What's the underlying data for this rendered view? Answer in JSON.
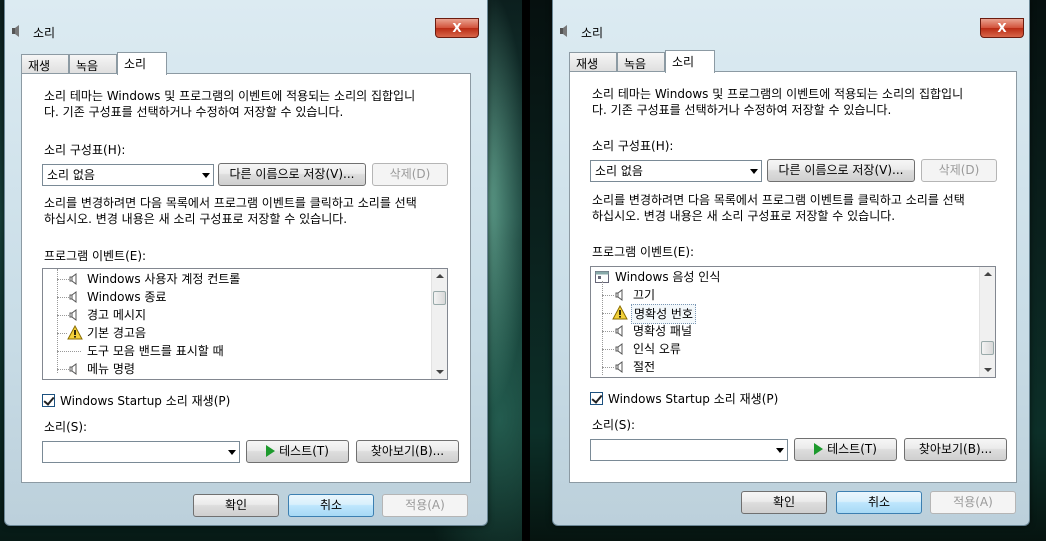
{
  "left": {
    "title": "소리",
    "close_label": "X",
    "tabs": [
      {
        "label": "재생"
      },
      {
        "label": "녹음"
      },
      {
        "label": "소리"
      }
    ],
    "description": "소리 테마는 Windows 및 프로그램의 이벤트에 적용되는 소리의 집합입니\n다. 기존 구성표를 선택하거나 수정하여 저장할 수 있습니다.",
    "scheme_label": "소리 구성표(H):",
    "scheme_value": "소리 없음",
    "save_as_label": "다른 이름으로 저장(V)...",
    "delete_label": "삭제(D)",
    "instruction": "소리를 변경하려면 다음 목록에서 프로그램 이벤트를 클릭하고 소리를 선택\n하십시오. 변경 내용은 새 소리 구성표로 저장할 수 있습니다.",
    "events_label": "프로그램 이벤트(E):",
    "events": [
      {
        "label": "Windows 사용자 계정 컨트롤",
        "icon": "speaker-icon"
      },
      {
        "label": "Windows 종료",
        "icon": "speaker-icon"
      },
      {
        "label": "경고 메시지",
        "icon": "speaker-icon"
      },
      {
        "label": "기본 경고음",
        "icon": "warning-icon"
      },
      {
        "label": "도구 모음 밴드를 표시할 때",
        "icon": ""
      },
      {
        "label": "메뉴 명령",
        "icon": "speaker-icon"
      }
    ],
    "startup_label": "Windows Startup 소리 재생(P)",
    "startup_checked": true,
    "sound_label": "소리(S):",
    "sound_value": "",
    "test_label": "테스트(T)",
    "browse_label": "찾아보기(B)...",
    "ok_label": "확인",
    "cancel_label": "취소",
    "apply_label": "적용(A)"
  },
  "right": {
    "title": "소리",
    "close_label": "X",
    "tabs": [
      {
        "label": "재생"
      },
      {
        "label": "녹음"
      },
      {
        "label": "소리"
      }
    ],
    "description": "소리 테마는 Windows 및 프로그램의 이벤트에 적용되는 소리의 집합입니\n다. 기존 구성표를 선택하거나 수정하여 저장할 수 있습니다.",
    "scheme_label": "소리 구성표(H):",
    "scheme_value": "소리 없음",
    "save_as_label": "다른 이름으로 저장(V)...",
    "delete_label": "삭제(D)",
    "instruction": "소리를 변경하려면 다음 목록에서 프로그램 이벤트를 클릭하고 소리를 선택\n하십시오. 변경 내용은 새 소리 구성표로 저장할 수 있습니다.",
    "events_label": "프로그램 이벤트(E):",
    "group": "Windows 음성 인식",
    "events": [
      {
        "label": "끄기",
        "icon": "speaker-icon"
      },
      {
        "label": "명확성 번호",
        "icon": "warning-icon"
      },
      {
        "label": "명확성 패널",
        "icon": "speaker-icon"
      },
      {
        "label": "인식 오류",
        "icon": "speaker-icon"
      },
      {
        "label": "절전",
        "icon": "speaker-icon"
      }
    ],
    "startup_label": "Windows Startup 소리 재생(P)",
    "startup_checked": true,
    "sound_label": "소리(S):",
    "sound_value": "",
    "test_label": "테스트(T)",
    "browse_label": "찾아보기(B)...",
    "ok_label": "확인",
    "cancel_label": "취소",
    "apply_label": "적용(A)"
  }
}
